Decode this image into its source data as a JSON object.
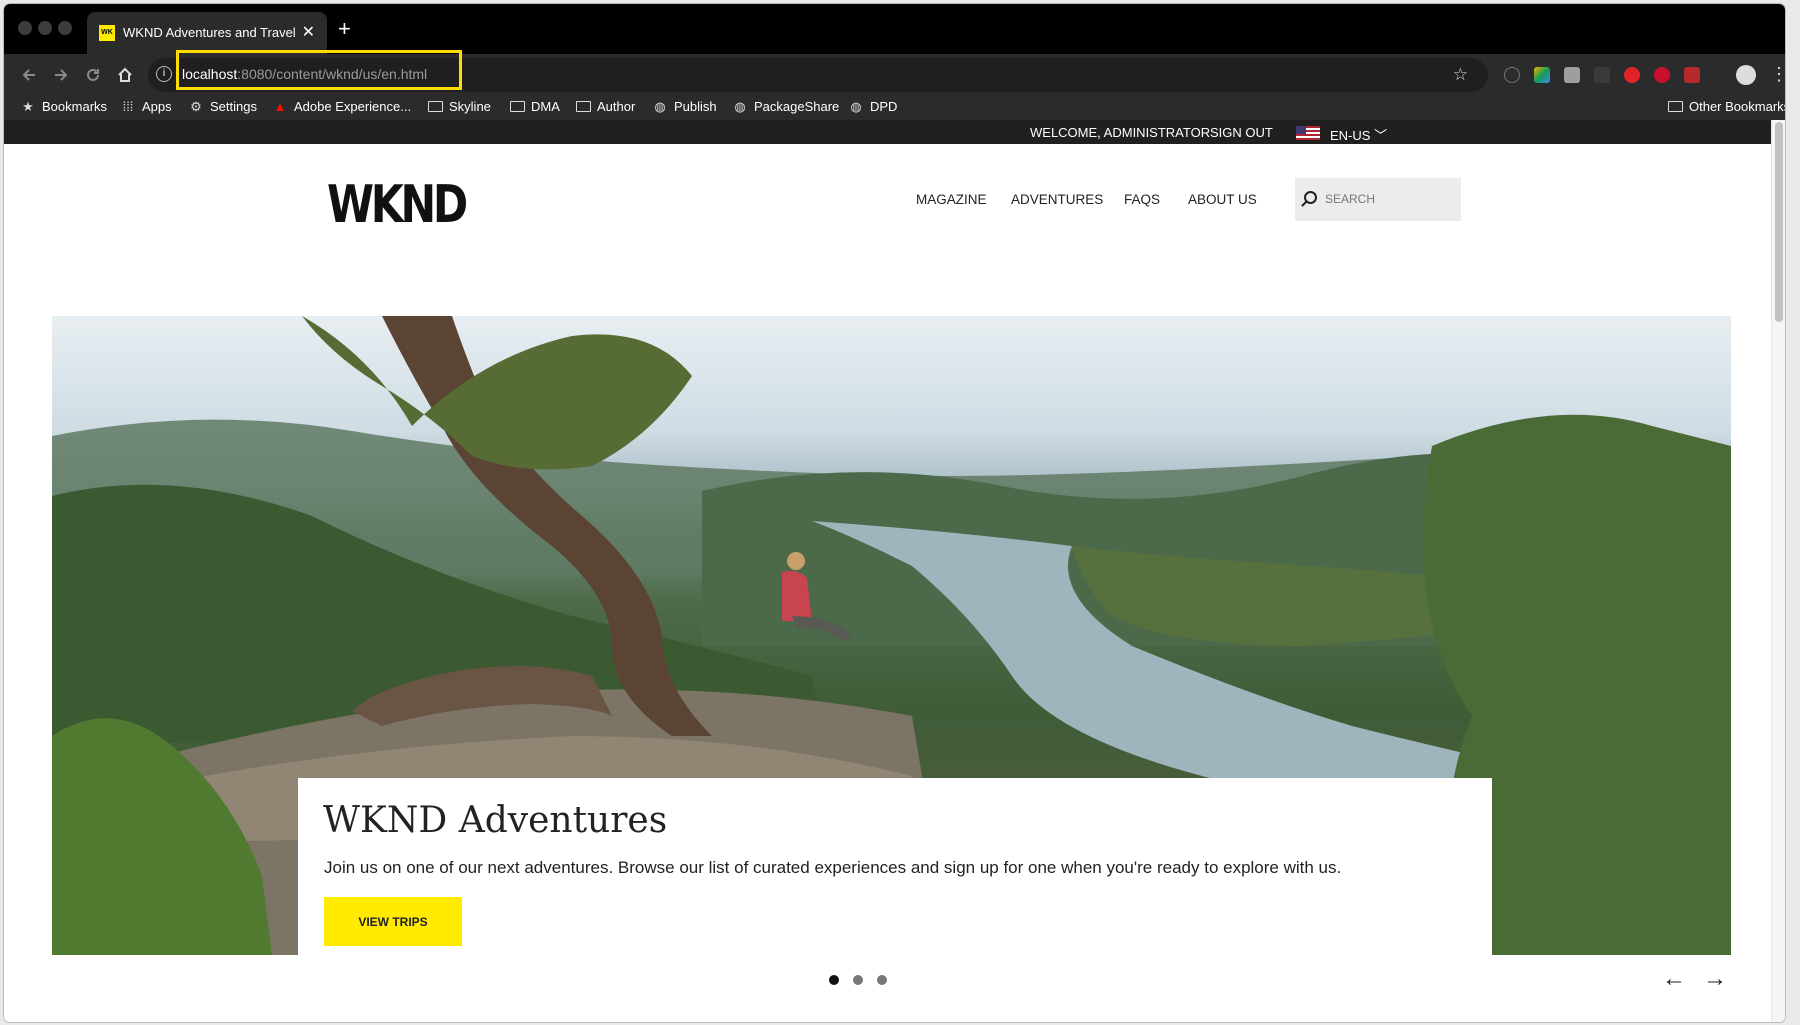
{
  "browser": {
    "tab_title": "WKND Adventures and Travel",
    "tab_favicon_text": "WK",
    "close_glyph": "✕",
    "new_tab_glyph": "+",
    "url_host": "localhost",
    "url_rest": ":8080/content/wknd/us/en.html",
    "info_glyph": "i",
    "back_icon": "arrow-left-icon",
    "forward_icon": "arrow-right-icon",
    "reload_icon": "reload-icon",
    "home_icon": "home-icon",
    "bookmark_star_icon": "star-icon",
    "highlight_color": "#ffdd00"
  },
  "bookmarks": {
    "items": [
      "Bookmarks",
      "Apps",
      "Settings",
      "Adobe Experience...",
      "Skyline",
      "DMA",
      "Author",
      "Publish",
      "PackageShare",
      "DPD"
    ],
    "other": "Other Bookmarks"
  },
  "site": {
    "welcome": "WELCOME, ADMINISTRATOR",
    "sign_out": "SIGN OUT",
    "language": "EN-US",
    "logo": "WKND",
    "nav": [
      "MAGAZINE",
      "ADVENTURES",
      "FAQS",
      "ABOUT US"
    ],
    "search_placeholder": "SEARCH",
    "accent_color": "#ffea00"
  },
  "hero": {
    "title": "WKND Adventures",
    "text": "Join us on one of our next adventures. Browse our list of curated experiences and sign up for one when you're ready to explore with us.",
    "button": "VIEW TRIPS",
    "slides": 3,
    "active_slide": 1,
    "prev_arrow": "←",
    "next_arrow": "→"
  }
}
